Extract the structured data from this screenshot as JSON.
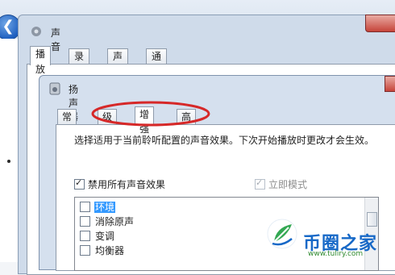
{
  "sound_dialog": {
    "title": "声音",
    "tabs": [
      {
        "label": "播放",
        "active": true
      },
      {
        "label": "录制",
        "active": false
      },
      {
        "label": "声音",
        "active": false
      },
      {
        "label": "通信",
        "active": false
      }
    ]
  },
  "speaker_dialog": {
    "title": "扬声器 属性",
    "tabs": [
      {
        "label": "常规",
        "active": false
      },
      {
        "label": "级别",
        "active": false
      },
      {
        "label": "增强",
        "active": true
      },
      {
        "label": "高级",
        "active": false
      }
    ],
    "description": "选择适用于当前聆听配置的声音效果。下次开始播放时更改才会生效。",
    "disable_all_label": "禁用所有声音效果",
    "disable_all_checked": true,
    "immediate_mode_label": "立即模式",
    "immediate_mode_checked": true,
    "effects": [
      {
        "label": "环境",
        "checked": false,
        "selected": true
      },
      {
        "label": "消除原声",
        "checked": false,
        "selected": false
      },
      {
        "label": "变调",
        "checked": false,
        "selected": false
      },
      {
        "label": "均衡器",
        "checked": false,
        "selected": false
      }
    ]
  },
  "watermark": {
    "brand": "币圈之家",
    "url": "www.tuliry.com"
  },
  "colors": {
    "highlight": "#d62828",
    "selection": "#3399ff"
  }
}
